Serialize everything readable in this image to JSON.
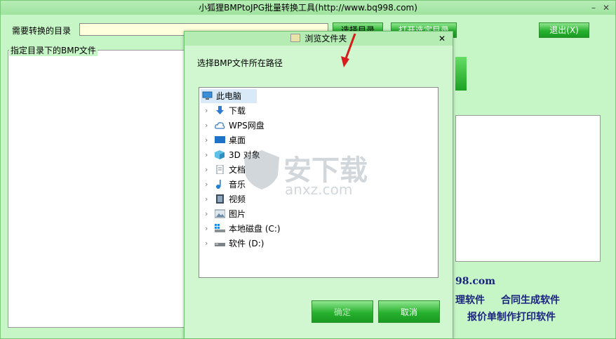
{
  "main": {
    "title": "小狐狸BMPtoJPG批量转换工具(http://www.bq998.com)",
    "dir_label": "需要转换的目录",
    "select_dir_btn": "选择目录",
    "open_dir_btn": "打开选定目录",
    "exit_btn": "退出(X)",
    "group_caption": "指定目录下的BMP文件",
    "promo_url": "98.com",
    "promo_line1a": "理软件",
    "promo_line1b": "合同生成软件",
    "promo_line2": "报价单制作打印软件"
  },
  "dialog": {
    "title": "浏览文件夹",
    "prompt": "选择BMP文件所在路径",
    "ok_btn": "确定",
    "cancel_btn": "取消",
    "tree": [
      {
        "label": "此电脑",
        "icon": "computer-icon"
      },
      {
        "label": "下载",
        "icon": "download-icon"
      },
      {
        "label": "WPS网盘",
        "icon": "cloud-icon"
      },
      {
        "label": "桌面",
        "icon": "desktop-icon"
      },
      {
        "label": "3D 对象",
        "icon": "3d-objects-icon"
      },
      {
        "label": "文档",
        "icon": "document-icon"
      },
      {
        "label": "音乐",
        "icon": "music-icon"
      },
      {
        "label": "视频",
        "icon": "video-icon"
      },
      {
        "label": "图片",
        "icon": "picture-icon"
      },
      {
        "label": "本地磁盘 (C:)",
        "icon": "local-disk-icon"
      },
      {
        "label": "软件 (D:)",
        "icon": "drive-icon"
      }
    ]
  },
  "watermark": {
    "cn": "安下载",
    "en": "anxz.com"
  }
}
